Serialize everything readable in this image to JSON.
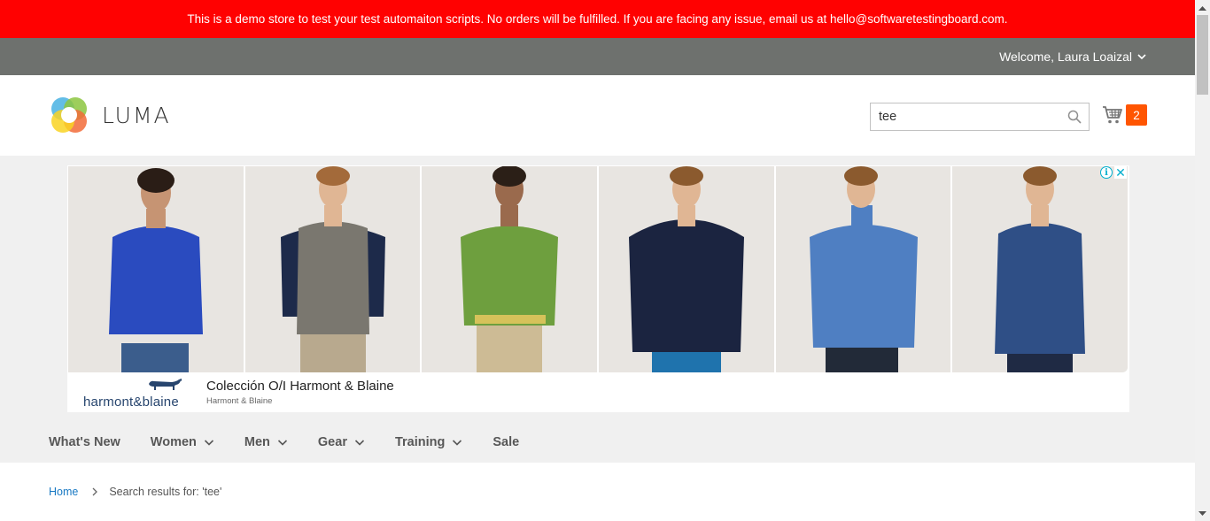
{
  "demo_notice": "This is a demo store to test your test automaiton scripts. No orders will be fulfilled. If you are facing any issue, email us at hello@softwaretestingboard.com.",
  "header": {
    "welcome_text": "Welcome, Laura Loaizal",
    "logo_text": "LUMA",
    "search": {
      "value": "tee",
      "icon": "search-icon"
    },
    "cart": {
      "count": "2",
      "icon": "cart-icon",
      "badge_color": "#ff5501"
    }
  },
  "ad": {
    "title": "Colección O/I Harmont & Blaine",
    "advertiser": "Harmont & Blaine",
    "brand_logo_text": "harmont&blaine",
    "choices_icon": "info-icon",
    "close_icon": "close-icon",
    "tiles": [
      {
        "garment": "blue sweater",
        "color": "#2a4bbf"
      },
      {
        "garment": "gray puffer vest",
        "color": "#7a776f"
      },
      {
        "garment": "green sweater",
        "color": "#6e9f3e"
      },
      {
        "garment": "navy puffer jacket",
        "color": "#1b2440"
      },
      {
        "garment": "light blue turtleneck",
        "color": "#4f7fc2"
      },
      {
        "garment": "denim shirt",
        "color": "#2f4f86"
      }
    ]
  },
  "nav": {
    "items": [
      {
        "label": "What's New",
        "dropdown": false
      },
      {
        "label": "Women",
        "dropdown": true
      },
      {
        "label": "Men",
        "dropdown": true
      },
      {
        "label": "Gear",
        "dropdown": true
      },
      {
        "label": "Training",
        "dropdown": true
      },
      {
        "label": "Sale",
        "dropdown": false
      }
    ]
  },
  "breadcrumb": {
    "home": "Home",
    "current": "Search results for: 'tee'"
  },
  "colors": {
    "banner": "#ff0101",
    "panel_header": "#6e716e",
    "link": "#1979c3"
  }
}
